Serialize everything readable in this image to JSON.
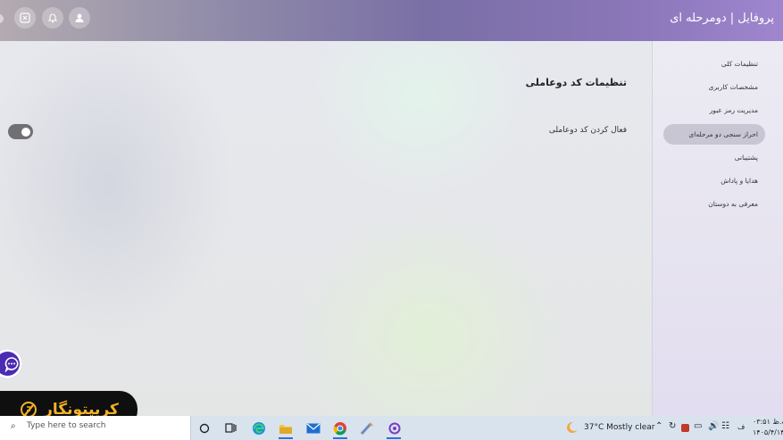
{
  "header": {
    "title": "پروفایل | دومرحله ای",
    "buttons": [
      "user-icon",
      "bell-icon",
      "calculator-icon"
    ]
  },
  "main": {
    "section_title": "تنظیمات کد دوعاملی",
    "setting_label": "فعال کردن کد دوعاملی",
    "toggle_on": true
  },
  "sidebar": {
    "items": [
      {
        "label": "تنظیمات کلی",
        "active": false
      },
      {
        "label": "مشخصات کاربری",
        "active": false
      },
      {
        "label": "مدیریت رمز عبور",
        "active": false
      },
      {
        "label": "احراز سنجی دو مرحله‌ای",
        "active": true
      },
      {
        "label": "پشتیبانی",
        "active": false
      },
      {
        "label": "هدایا و پاداش",
        "active": false
      },
      {
        "label": "معرفی به دوستان",
        "active": false
      }
    ]
  },
  "brand": {
    "name": "کریپتونگار"
  },
  "taskbar": {
    "search_placeholder": "Type here to search",
    "weather": "37°C  Mostly clear",
    "clock_time": "۰۳:۵۱ ب.ظ",
    "clock_date": "۱۴۰۵/۴/۱۴",
    "lang": "ف"
  },
  "colors": {
    "accent_purple": "#4c2bb3",
    "brand_gold": "#f4b226",
    "active_item": "#c9c6d3"
  }
}
